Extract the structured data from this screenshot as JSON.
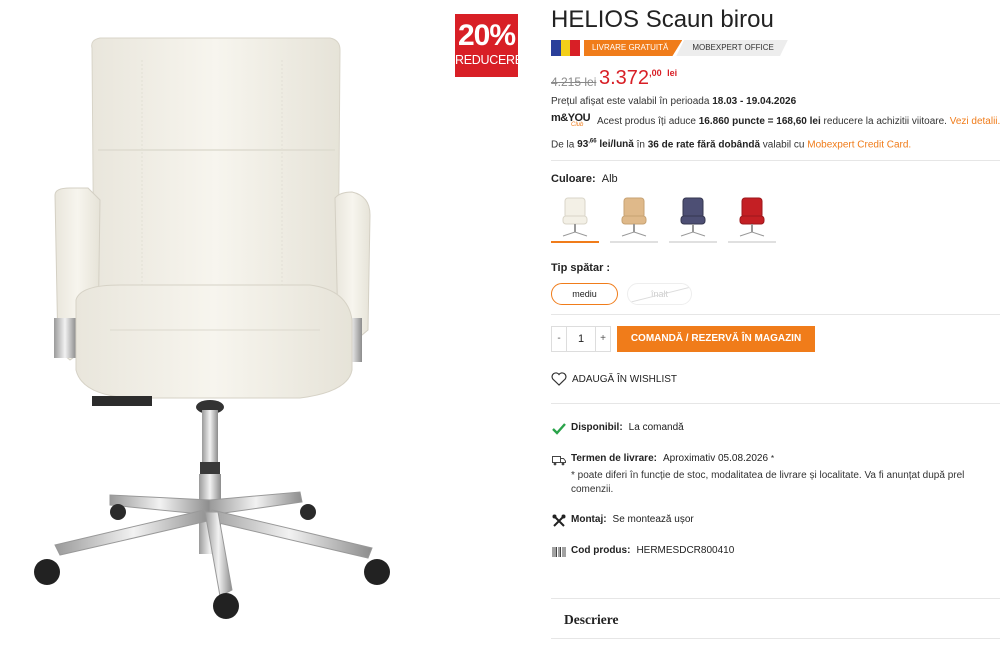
{
  "promo": {
    "percent": "20%",
    "label": "REDUCERE"
  },
  "product": {
    "title": "HELIOS Scaun birou",
    "tags": {
      "shipping": "LIVRARE GRATUITĂ",
      "brand": "MOBEXPERT OFFICE"
    },
    "price": {
      "old": "4.215 lei",
      "new_int": "3.372",
      "new_dec": ",00",
      "currency": "lei"
    },
    "period": {
      "prefix": "Prețul afișat este valabil în perioada",
      "dates": "18.03 - 19.04.2026"
    },
    "loyalty": {
      "logo": "m&YOU",
      "logo_sub": "Club",
      "prefix": "Acest produs îți aduce",
      "points": "16.860 puncte = 168,60 lei",
      "suffix": "reducere la achizitii viitoare.",
      "link": "Vezi detalii."
    },
    "installments": {
      "prefix": "De la",
      "amount_int": "93",
      "amount_dec": ",66",
      "unit": "lei/lună",
      "mid": "în",
      "months": "36 de rate fără dobândă",
      "suffix": "valabil cu",
      "card": "Mobexpert Credit Card."
    }
  },
  "color": {
    "label": "Culoare",
    "value": "Alb",
    "options": [
      "alb",
      "bej",
      "bleumarin",
      "rosu"
    ]
  },
  "back_type": {
    "label": "Tip spătar",
    "options": [
      {
        "label": "mediu",
        "state": "selected"
      },
      {
        "label": "înalt",
        "state": "unavailable"
      }
    ]
  },
  "cart": {
    "minus": "-",
    "qty": "1",
    "plus": "+",
    "order_label": "COMANDĂ / REZERVĂ ÎN MAGAZIN"
  },
  "wishlist_label": "ADAUGĂ ÎN WISHLIST",
  "availability": {
    "label": "Disponibil:",
    "value": "La comandă"
  },
  "delivery": {
    "label": "Termen de livrare:",
    "value": "Aproximativ 05.08.2026",
    "mark": "*",
    "note_line1": "* poate diferi în funcție de stoc, modalitatea de livrare și localitate. Va fi anunțat după prel",
    "note_line2": "comenzii."
  },
  "assembly": {
    "label": "Montaj:",
    "value": "Se montează ușor"
  },
  "code": {
    "label": "Cod produs:",
    "value": "HERMESDCR800410"
  },
  "description_label": "Descriere",
  "icons": [
    "heart-icon",
    "check-icon",
    "truck-icon",
    "tools-icon",
    "barcode-icon"
  ],
  "colors": {
    "accent": "#f07c1a",
    "price": "#d81f26",
    "check": "#2aa34a"
  }
}
